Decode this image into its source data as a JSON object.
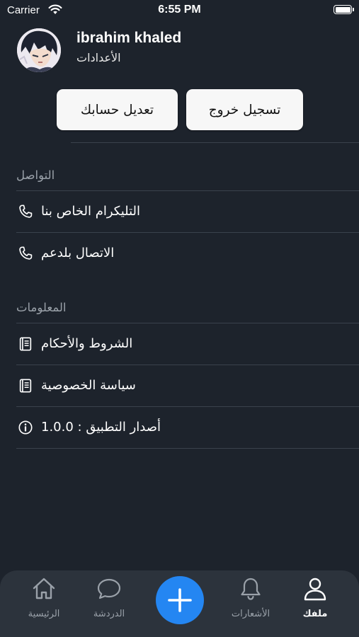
{
  "status_bar": {
    "carrier": "Carrier",
    "time": "6:55 PM"
  },
  "profile": {
    "name": "ibrahim khaled",
    "subtitle": "الأعدادات"
  },
  "buttons": {
    "logout": "تسجيل خروج",
    "edit_account": "تعديل حسابك"
  },
  "sections": [
    {
      "title": "التواصل",
      "items": [
        {
          "label": "التليكرام الخاص بنا",
          "icon": "phone-icon"
        },
        {
          "label": "الاتصال بلدعم",
          "icon": "phone-icon"
        }
      ]
    },
    {
      "title": "المعلومات",
      "items": [
        {
          "label": "الشروط والأحكام",
          "icon": "book-icon"
        },
        {
          "label": "سياسة الخصوصية",
          "icon": "book-icon"
        },
        {
          "label": "أصدار التطبيق : 1.0.0",
          "icon": "info-icon"
        }
      ]
    }
  ],
  "tab_bar": {
    "active": "profile",
    "accent": "#2486f2",
    "tabs": [
      {
        "id": "home",
        "label": "الرئيسية",
        "icon": "home-icon"
      },
      {
        "id": "chat",
        "label": "الدردشة",
        "icon": "chat-icon"
      },
      {
        "id": "add",
        "label": "",
        "icon": "plus-icon"
      },
      {
        "id": "notifications",
        "label": "الأشعارات",
        "icon": "bell-icon"
      },
      {
        "id": "profile",
        "label": "ملفك",
        "icon": "person-icon"
      }
    ]
  }
}
